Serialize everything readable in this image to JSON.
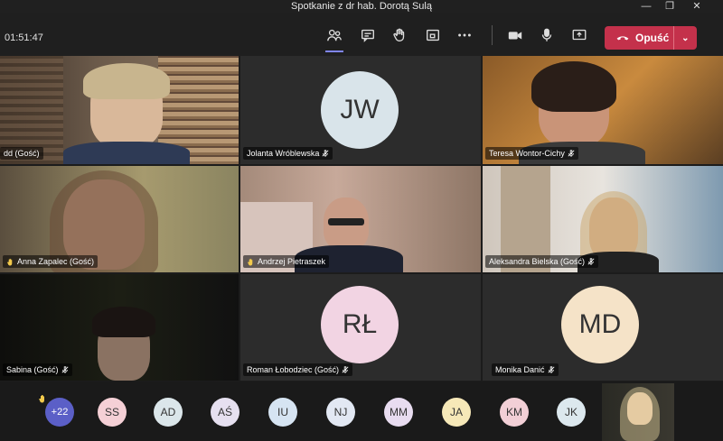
{
  "window": {
    "title": "Spotkanie z dr hab. Dorotą Sulą"
  },
  "toolbar": {
    "timer": "01:51:47",
    "leave_label": "Opuść",
    "icons": [
      "participants-icon",
      "chat-icon",
      "raise-hand-icon",
      "share-tray-icon",
      "more-icon",
      "camera-icon",
      "mic-icon",
      "share-icon"
    ]
  },
  "tiles": {
    "t1": {
      "name": "dd (Gość)"
    },
    "t2": {
      "name": "Jolanta Wróblewska",
      "initials": "JW"
    },
    "t3": {
      "name": "Teresa Wontor-Cichy"
    },
    "t4": {
      "name": "Anna Zapalec (Gość)"
    },
    "t5": {
      "name": "Andrzej Pietraszek"
    },
    "t6": {
      "name": "Aleksandra Bielska (Gość)"
    },
    "t7": {
      "name": "Sabina (Gość)"
    },
    "t8": {
      "name": "Roman Łobodziec (Gość)",
      "initials": "RŁ"
    },
    "t9": {
      "name": "Monika Danić",
      "initials": "MD"
    }
  },
  "strip": {
    "more_count": "+22",
    "chips": [
      "SS",
      "AD",
      "AŚ",
      "IU",
      "NJ",
      "MM",
      "JA",
      "KM",
      "JK"
    ]
  },
  "colors": {
    "accent": "#7f85f5",
    "leave": "#c4314b",
    "avatar_jw": "#d9e4ea",
    "avatar_rl": "#f2d4e3",
    "avatar_md": "#f5e3c8"
  }
}
